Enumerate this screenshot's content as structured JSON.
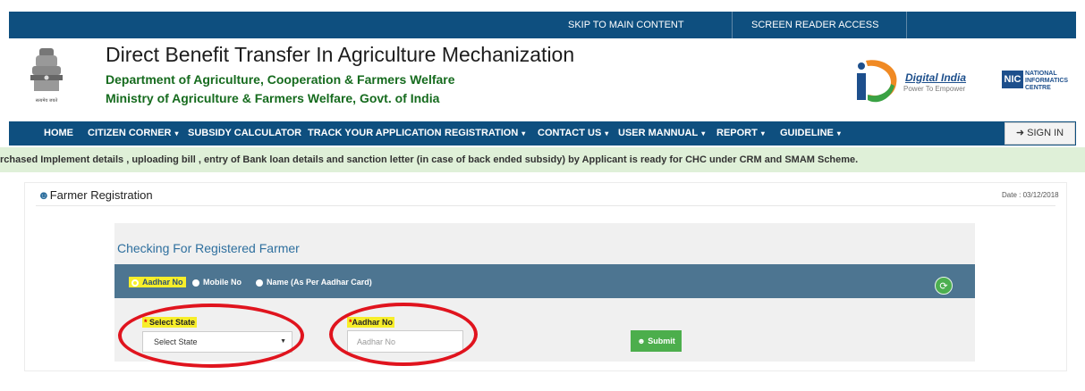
{
  "topbar": {
    "skip": "SKIP TO MAIN CONTENT",
    "reader": "SCREEN READER ACCESS"
  },
  "header": {
    "emblem_caption": "सत्यमेव जयते",
    "title": "Direct Benefit Transfer In Agriculture Mechanization",
    "dept": "Department of Agriculture, Cooperation & Farmers Welfare",
    "ministry": "Ministry of Agriculture & Farmers Welfare, Govt. of India",
    "digital_india": "Digital India",
    "digital_india_tag": "Power To Empower",
    "nic_mark": "NIC",
    "nic_text1": "NATIONAL",
    "nic_text2": "INFORMATICS",
    "nic_text3": "CENTRE"
  },
  "nav": {
    "items": [
      {
        "label": "HOME",
        "caret": ""
      },
      {
        "label": "CITIZEN CORNER",
        "caret": "▾"
      },
      {
        "label": "SUBSIDY CALCULATOR",
        "caret": ""
      },
      {
        "label": "TRACK YOUR APPLICATION",
        "caret": ""
      },
      {
        "label": "REGISTRATION",
        "caret": "▾"
      },
      {
        "label": "CONTACT US",
        "caret": "▾"
      },
      {
        "label": "USER MANNUAL",
        "caret": "▾"
      },
      {
        "label": "REPORT",
        "caret": "▾"
      },
      {
        "label": "GUIDELINE",
        "caret": "▾"
      }
    ],
    "signin": "SIGN IN"
  },
  "marquee": "rchased Implement details , uploading bill , entry of Bank loan details and sanction letter (in case of back ended subsidy) by Applicant is ready for CHC under CRM and SMAM Scheme.",
  "panel": {
    "title": "Farmer Registration",
    "date": "Date : 03/12/2018"
  },
  "check": {
    "title": "Checking For Registered Farmer",
    "radios": [
      "Aadhar No",
      "Mobile No",
      "Name (As Per Aadhar Card)"
    ],
    "selected_radio": "Aadhar No"
  },
  "form": {
    "state_label": "Select State",
    "state_value": "Select State",
    "aadhar_label": "Aadhar No",
    "aadhar_placeholder": "Aadhar No",
    "submit": "Submit",
    "required_mark": "*"
  },
  "colors": {
    "nav": "#0e4f7f",
    "green": "#166b1e",
    "highlight": "#f7ee2a",
    "annotation": "#e0141e"
  }
}
